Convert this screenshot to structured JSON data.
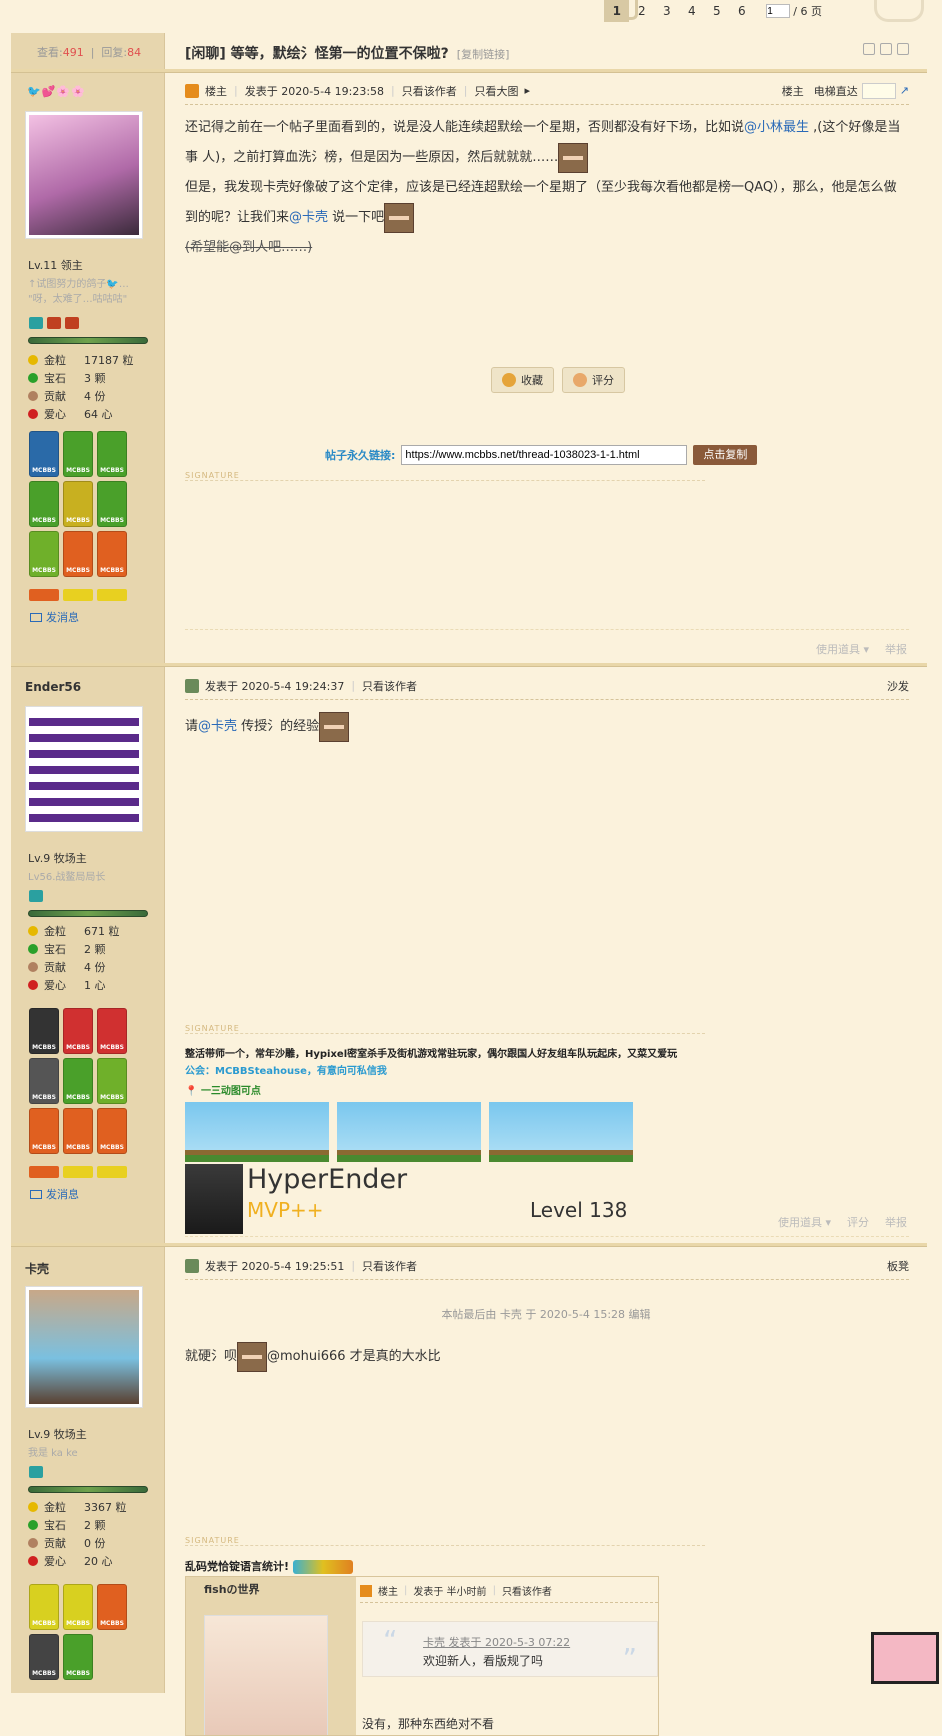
{
  "pager": {
    "pages": [
      "1",
      "2",
      "3",
      "4",
      "5",
      "6"
    ],
    "current": "1",
    "input_value": "1",
    "total": "/ 6 页"
  },
  "thread": {
    "views_label": "查看:",
    "views": "491",
    "replies_label": "回复:",
    "replies": "84",
    "title": "[闲聊] 等等，默绘氵怪第一的位置不保啦?",
    "copy_link": "[复制链接]"
  },
  "posts": [
    {
      "author_emojis": "🐦💕🌸🌸",
      "level": "Lv.11 领主",
      "custom_title": "↑试图努力的鸽子🐦…\n\"呀，太难了…咕咕咕\"",
      "credits": [
        {
          "k": "金粒",
          "v": "17187 粒",
          "c": "#e6b800"
        },
        {
          "k": "宝石",
          "v": "3 颗",
          "c": "#2aa02a"
        },
        {
          "k": "贡献",
          "v": "4 份",
          "c": "#b08060"
        },
        {
          "k": "爱心",
          "v": "64 心",
          "c": "#d02020"
        }
      ],
      "medal_colors": [
        "#2a6aa8",
        "#4aa02a",
        "#4aa02a",
        "#4aa02a",
        "#4aa02a",
        "#4aa02a",
        "#4aa02a",
        "#e06020",
        "#e06020"
      ],
      "medal_text": "MCBBS",
      "send_msg": "发消息",
      "badge_label": "楼主",
      "posted": "发表于 2020-5-4 19:23:58",
      "only_author": "只看该作者",
      "big_img": "只看大图",
      "floor": "楼主",
      "ladder": "电梯直达",
      "body_1a": "还记得之前在一个帖子里面看到的，说是没人能连续超默绘一个星期，否则都没有好下场，比如说",
      "mention_1": "@小林最生",
      "body_1b": " ,(这个好像是当 事 人)，之前打算血洗氵榜，但是因为一些原因，然后就就就……",
      "body_2": "但是，我发现卡壳好像破了这个定律，应该是已经连超默绘一个星期了（至少我每次看他都是榜一QAQ），那么，他是怎么做到的呢？让我们来",
      "mention_2": "@卡壳",
      "body_2b": " 说一下吧",
      "body_3": "(希望能@到人吧……)",
      "fav": "收藏",
      "rate": "评分",
      "permalink_label": "帖子永久链接:",
      "permalink": "https://www.mcbbs.net/thread-1038023-1-1.html",
      "copy_btn": "点击复制",
      "sig": "SIGNATURE",
      "tools": "使用道具 ▾",
      "report": "举报"
    },
    {
      "author": "Ender56",
      "level": "Lv.9 牧场主",
      "custom_title": "Lv56.战鳌局局长",
      "credits": [
        {
          "k": "金粒",
          "v": "671 粒",
          "c": "#e6b800"
        },
        {
          "k": "宝石",
          "v": "2 颗",
          "c": "#2aa02a"
        },
        {
          "k": "贡献",
          "v": "4 份",
          "c": "#b08060"
        },
        {
          "k": "爱心",
          "v": "1 心",
          "c": "#d02020"
        }
      ],
      "medal_colors": [
        "#333",
        "#d03030",
        "#d03030",
        "#555",
        "#4aa02a",
        "#4aa02a",
        "#e06020",
        "#e06020",
        "#e06020"
      ],
      "send_msg": "发消息",
      "posted": "发表于 2020-5-4 19:24:37",
      "only_author": "只看该作者",
      "floor": "沙发",
      "body_a": "请",
      "mention": "@卡壳",
      "body_b": " 传授氵的经验",
      "sig": "SIGNATURE",
      "sig_line1": "整活带师一个，常年沙雕，Hypixel密室杀手及街机游戏常驻玩家，偶尔跟国人好友组车队玩起床，又菜又爱玩",
      "sig_line2": "公会：MCBBSteahouse，有意向可私信我",
      "sig_line3": "一三动图可点",
      "mc_name": "HyperEnder",
      "mc_rank": "MVP++",
      "mc_level": "Level 138",
      "tools": "使用道具 ▾",
      "rate": "评分",
      "report": "举报"
    },
    {
      "author": "卡壳",
      "level": "Lv.9 牧场主",
      "custom_title": "我是 ka ke",
      "credits": [
        {
          "k": "金粒",
          "v": "3367 粒",
          "c": "#e6b800"
        },
        {
          "k": "宝石",
          "v": "2 颗",
          "c": "#2aa02a"
        },
        {
          "k": "贡献",
          "v": "0 份",
          "c": "#b08060"
        },
        {
          "k": "爱心",
          "v": "20 心",
          "c": "#d02020"
        }
      ],
      "medal_colors": [
        "#d8d020",
        "#d8d020",
        "#e06020",
        "#444",
        "#4aa02a"
      ],
      "posted": "发表于 2020-5-4 19:25:51",
      "only_author": "只看该作者",
      "floor": "板凳",
      "edit_note": "本帖最后由 卡壳 于 2020-5-4 15:28 编辑",
      "body_a": "就硬氵呗",
      "body_b": "@mohui666 才是真的大水比",
      "sig": "SIGNATURE",
      "sig_text": "乱码党恰锭语言统计!",
      "nested_author": "fishの世界",
      "nested_badge": "楼主",
      "nested_posted": "发表于 半小时前",
      "nested_only": "只看该作者",
      "quote_head": "卡壳 发表于 2020-5-3 07:22",
      "quote_body": "欢迎新人，看版规了吗",
      "nested_reply": "没有，那种东西绝对不看"
    }
  ]
}
